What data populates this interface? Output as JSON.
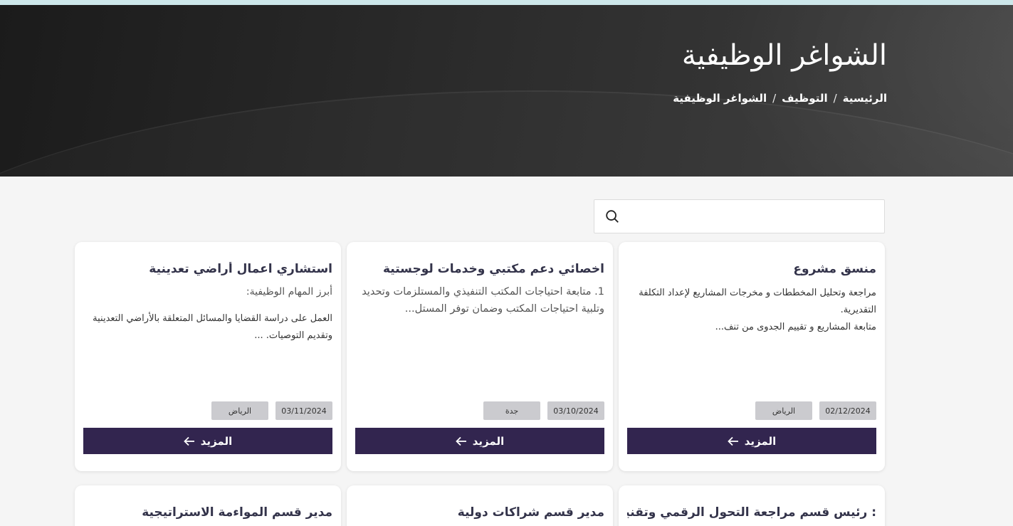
{
  "hero": {
    "title": "الشواغر الوظيفية",
    "breadcrumb": [
      "الرئيسية",
      "التوظيف",
      "الشواغر الوظيفية"
    ],
    "separator": "/"
  },
  "search": {
    "placeholder": "",
    "value": ""
  },
  "more_label": "المزيد",
  "more_icon": "arrow-left-icon",
  "search_icon": "search-icon",
  "colors": {
    "button": "#32254f",
    "tag": "#cbcbcf",
    "topbar": "#cde7ea"
  },
  "jobs": [
    {
      "title": "منسق مشروع",
      "desc": [
        "مراجعة وتحليل المخططات و مخرجات المشاريع لإعداد التكلفة التقديرية.",
        "متابعة المشاريع و تقييم الجدوى من تنف..."
      ],
      "date": "02/12/2024",
      "city": "الرياض"
    },
    {
      "title": "اخصائي دعم مكتبي وخدمات لوجستية",
      "desc": [
        "1.   متابعة احتياجات المكتب التنفيذي والمستلزمات وتحديد وتلبية احتياجات المكتب وضمان توفر المستل..."
      ],
      "date": "03/10/2024",
      "city": "جدة"
    },
    {
      "title": "استشاري اعمال أراضي تعدينية",
      "desc": [
        "أبرز المهام الوظيفية:",
        "العمل على دراسة القضايا والمسائل المتعلقة بالأراضي التعدينية وتقديم التوصيات. ..."
      ],
      "date": "03/11/2024",
      "city": "الرياض"
    },
    {
      "title": ": رئيس قسم مراجعة التحول الرقمي وتقنية"
    },
    {
      "title": "مدير قسم شراكات دولية"
    },
    {
      "title": "مدير قسم المواءمة الاستراتيجية"
    }
  ]
}
